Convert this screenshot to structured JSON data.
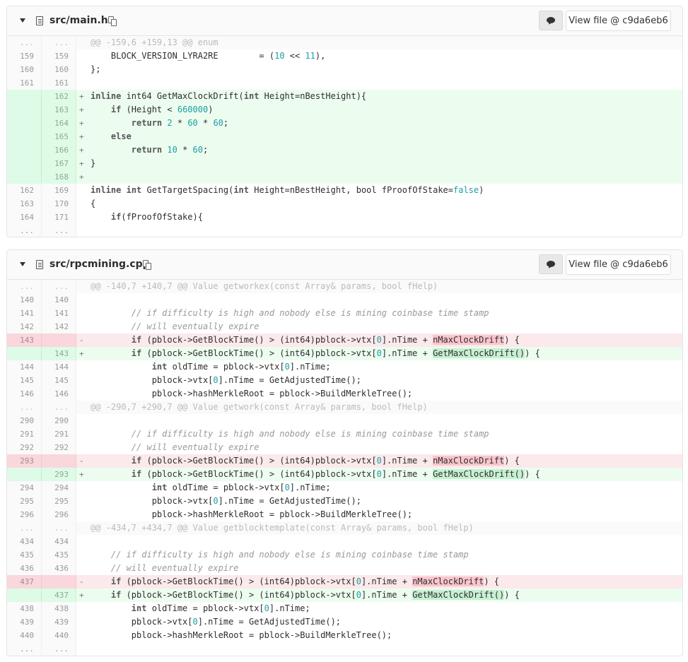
{
  "files": [
    {
      "name": "src/main.h",
      "view_button": "View file @ c9da6eb6",
      "lines": [
        {
          "t": "hunk",
          "o": "...",
          "n": "...",
          "s": "",
          "segs": [
            [
              "p",
              "@@ -159,6 +159,13 @@ enum"
            ]
          ]
        },
        {
          "t": "ctx",
          "o": "159",
          "n": "159",
          "s": "",
          "segs": [
            [
              "p",
              "    BLOCK_VERSION_LYRA2RE        = ("
            ],
            [
              "num",
              "10"
            ],
            [
              "p",
              " << "
            ],
            [
              "num",
              "11"
            ],
            [
              "p",
              "),"
            ]
          ]
        },
        {
          "t": "ctx",
          "o": "160",
          "n": "160",
          "s": "",
          "segs": [
            [
              "p",
              "};"
            ]
          ]
        },
        {
          "t": "ctx",
          "o": "161",
          "n": "161",
          "s": "",
          "segs": [
            [
              "p",
              ""
            ]
          ]
        },
        {
          "t": "add",
          "o": "",
          "n": "162",
          "s": "+",
          "segs": [
            [
              "kw",
              "inline"
            ],
            [
              "p",
              " int64 GetMaxClockDrift("
            ],
            [
              "kw",
              "int"
            ],
            [
              "p",
              " Height=nBestHeight){"
            ]
          ]
        },
        {
          "t": "add",
          "o": "",
          "n": "163",
          "s": "+",
          "segs": [
            [
              "p",
              "    "
            ],
            [
              "kw",
              "if"
            ],
            [
              "p",
              " (Height < "
            ],
            [
              "num",
              "660000"
            ],
            [
              "p",
              ")"
            ]
          ]
        },
        {
          "t": "add",
          "o": "",
          "n": "164",
          "s": "+",
          "segs": [
            [
              "p",
              "        "
            ],
            [
              "kw",
              "return"
            ],
            [
              "p",
              " "
            ],
            [
              "num",
              "2"
            ],
            [
              "p",
              " * "
            ],
            [
              "num",
              "60"
            ],
            [
              "p",
              " * "
            ],
            [
              "num",
              "60"
            ],
            [
              "p",
              ";"
            ]
          ]
        },
        {
          "t": "add",
          "o": "",
          "n": "165",
          "s": "+",
          "segs": [
            [
              "p",
              "    "
            ],
            [
              "kw",
              "else"
            ]
          ]
        },
        {
          "t": "add",
          "o": "",
          "n": "166",
          "s": "+",
          "segs": [
            [
              "p",
              "        "
            ],
            [
              "kw",
              "return"
            ],
            [
              "p",
              " "
            ],
            [
              "num",
              "10"
            ],
            [
              "p",
              " * "
            ],
            [
              "num",
              "60"
            ],
            [
              "p",
              ";"
            ]
          ]
        },
        {
          "t": "add",
          "o": "",
          "n": "167",
          "s": "+",
          "segs": [
            [
              "p",
              "}"
            ]
          ]
        },
        {
          "t": "add",
          "o": "",
          "n": "168",
          "s": "+",
          "segs": [
            [
              "p",
              ""
            ]
          ]
        },
        {
          "t": "ctx",
          "o": "162",
          "n": "169",
          "s": "",
          "segs": [
            [
              "kw",
              "inline"
            ],
            [
              "p",
              " "
            ],
            [
              "kw",
              "int"
            ],
            [
              "p",
              " GetTargetSpacing("
            ],
            [
              "kw",
              "int"
            ],
            [
              "p",
              " Height=nBestHeight, bool fProofOfStake="
            ],
            [
              "num",
              "false"
            ],
            [
              "p",
              ")"
            ]
          ]
        },
        {
          "t": "ctx",
          "o": "163",
          "n": "170",
          "s": "",
          "segs": [
            [
              "p",
              "{"
            ]
          ]
        },
        {
          "t": "ctx",
          "o": "164",
          "n": "171",
          "s": "",
          "segs": [
            [
              "p",
              "    "
            ],
            [
              "kw",
              "if"
            ],
            [
              "p",
              "(fProofOfStake){"
            ]
          ]
        },
        {
          "t": "ctx",
          "o": "...",
          "n": "...",
          "s": "",
          "segs": [
            [
              "p",
              ""
            ]
          ]
        }
      ]
    },
    {
      "name": "src/rpcmining.cpp",
      "view_button": "View file @ c9da6eb6",
      "lines": [
        {
          "t": "hunk",
          "o": "...",
          "n": "...",
          "s": "",
          "segs": [
            [
              "p",
              "@@ -140,7 +140,7 @@ Value getworkex(const Array& params, bool fHelp)"
            ]
          ]
        },
        {
          "t": "ctx",
          "o": "140",
          "n": "140",
          "s": "",
          "segs": [
            [
              "p",
              ""
            ]
          ]
        },
        {
          "t": "ctx",
          "o": "141",
          "n": "141",
          "s": "",
          "segs": [
            [
              "p",
              "        "
            ],
            [
              "cm",
              "// if difficulty is high and nobody else is mining coinbase time stamp"
            ]
          ]
        },
        {
          "t": "ctx",
          "o": "142",
          "n": "142",
          "s": "",
          "segs": [
            [
              "p",
              "        "
            ],
            [
              "cm",
              "// will eventually expire"
            ]
          ]
        },
        {
          "t": "del",
          "o": "143",
          "n": "",
          "s": "-",
          "segs": [
            [
              "p",
              "        "
            ],
            [
              "kw",
              "if"
            ],
            [
              "p",
              " (pblock->GetBlockTime() > (int64)pblock->vtx["
            ],
            [
              "num",
              "0"
            ],
            [
              "p",
              "].nTime + "
            ],
            [
              "hd",
              "nMaxClockDrift"
            ],
            [
              "p",
              ") {"
            ]
          ]
        },
        {
          "t": "add",
          "o": "",
          "n": "143",
          "s": "+",
          "segs": [
            [
              "p",
              "        "
            ],
            [
              "kw",
              "if"
            ],
            [
              "p",
              " (pblock->GetBlockTime() > (int64)pblock->vtx["
            ],
            [
              "num",
              "0"
            ],
            [
              "p",
              "].nTime + "
            ],
            [
              "ha",
              "GetMaxClockDrift()"
            ],
            [
              "p",
              ") {"
            ]
          ]
        },
        {
          "t": "ctx",
          "o": "144",
          "n": "144",
          "s": "",
          "segs": [
            [
              "p",
              "            "
            ],
            [
              "kw",
              "int"
            ],
            [
              "p",
              " oldTime = pblock->vtx["
            ],
            [
              "num",
              "0"
            ],
            [
              "p",
              "].nTime;"
            ]
          ]
        },
        {
          "t": "ctx",
          "o": "145",
          "n": "145",
          "s": "",
          "segs": [
            [
              "p",
              "            pblock->vtx["
            ],
            [
              "num",
              "0"
            ],
            [
              "p",
              "].nTime = GetAdjustedTime();"
            ]
          ]
        },
        {
          "t": "ctx",
          "o": "146",
          "n": "146",
          "s": "",
          "segs": [
            [
              "p",
              "            pblock->hashMerkleRoot = pblock->BuildMerkleTree();"
            ]
          ]
        },
        {
          "t": "hunk",
          "o": "...",
          "n": "...",
          "s": "",
          "segs": [
            [
              "p",
              "@@ -290,7 +290,7 @@ Value getwork(const Array& params, bool fHelp)"
            ]
          ]
        },
        {
          "t": "ctx",
          "o": "290",
          "n": "290",
          "s": "",
          "segs": [
            [
              "p",
              ""
            ]
          ]
        },
        {
          "t": "ctx",
          "o": "291",
          "n": "291",
          "s": "",
          "segs": [
            [
              "p",
              "        "
            ],
            [
              "cm",
              "// if difficulty is high and nobody else is mining coinbase time stamp"
            ]
          ]
        },
        {
          "t": "ctx",
          "o": "292",
          "n": "292",
          "s": "",
          "segs": [
            [
              "p",
              "        "
            ],
            [
              "cm",
              "// will eventually expire"
            ]
          ]
        },
        {
          "t": "del",
          "o": "293",
          "n": "",
          "s": "-",
          "segs": [
            [
              "p",
              "        "
            ],
            [
              "kw",
              "if"
            ],
            [
              "p",
              " (pblock->GetBlockTime() > (int64)pblock->vtx["
            ],
            [
              "num",
              "0"
            ],
            [
              "p",
              "].nTime + "
            ],
            [
              "hd",
              "nMaxClockDrift"
            ],
            [
              "p",
              ") {"
            ]
          ]
        },
        {
          "t": "add",
          "o": "",
          "n": "293",
          "s": "+",
          "segs": [
            [
              "p",
              "        "
            ],
            [
              "kw",
              "if"
            ],
            [
              "p",
              " (pblock->GetBlockTime() > (int64)pblock->vtx["
            ],
            [
              "num",
              "0"
            ],
            [
              "p",
              "].nTime + "
            ],
            [
              "ha",
              "GetMaxClockDrift()"
            ],
            [
              "p",
              ") {"
            ]
          ]
        },
        {
          "t": "ctx",
          "o": "294",
          "n": "294",
          "s": "",
          "segs": [
            [
              "p",
              "            "
            ],
            [
              "kw",
              "int"
            ],
            [
              "p",
              " oldTime = pblock->vtx["
            ],
            [
              "num",
              "0"
            ],
            [
              "p",
              "].nTime;"
            ]
          ]
        },
        {
          "t": "ctx",
          "o": "295",
          "n": "295",
          "s": "",
          "segs": [
            [
              "p",
              "            pblock->vtx["
            ],
            [
              "num",
              "0"
            ],
            [
              "p",
              "].nTime = GetAdjustedTime();"
            ]
          ]
        },
        {
          "t": "ctx",
          "o": "296",
          "n": "296",
          "s": "",
          "segs": [
            [
              "p",
              "            pblock->hashMerkleRoot = pblock->BuildMerkleTree();"
            ]
          ]
        },
        {
          "t": "hunk",
          "o": "...",
          "n": "...",
          "s": "",
          "segs": [
            [
              "p",
              "@@ -434,7 +434,7 @@ Value getblocktemplate(const Array& params, bool fHelp)"
            ]
          ]
        },
        {
          "t": "ctx",
          "o": "434",
          "n": "434",
          "s": "",
          "segs": [
            [
              "p",
              ""
            ]
          ]
        },
        {
          "t": "ctx",
          "o": "435",
          "n": "435",
          "s": "",
          "segs": [
            [
              "p",
              "    "
            ],
            [
              "cm",
              "// if difficulty is high and nobody else is mining coinbase time stamp"
            ]
          ]
        },
        {
          "t": "ctx",
          "o": "436",
          "n": "436",
          "s": "",
          "segs": [
            [
              "p",
              "    "
            ],
            [
              "cm",
              "// will eventually expire"
            ]
          ]
        },
        {
          "t": "del",
          "o": "437",
          "n": "",
          "s": "-",
          "segs": [
            [
              "p",
              "    "
            ],
            [
              "kw",
              "if"
            ],
            [
              "p",
              " (pblock->GetBlockTime() > (int64)pblock->vtx["
            ],
            [
              "num",
              "0"
            ],
            [
              "p",
              "].nTime + "
            ],
            [
              "hd",
              "nMaxClockDrift"
            ],
            [
              "p",
              ") {"
            ]
          ]
        },
        {
          "t": "add",
          "o": "",
          "n": "437",
          "s": "+",
          "segs": [
            [
              "p",
              "    "
            ],
            [
              "kw",
              "if"
            ],
            [
              "p",
              " (pblock->GetBlockTime() > (int64)pblock->vtx["
            ],
            [
              "num",
              "0"
            ],
            [
              "p",
              "].nTime + "
            ],
            [
              "ha",
              "GetMaxClockDrift()"
            ],
            [
              "p",
              ") {"
            ]
          ]
        },
        {
          "t": "ctx",
          "o": "438",
          "n": "438",
          "s": "",
          "segs": [
            [
              "p",
              "        "
            ],
            [
              "kw",
              "int"
            ],
            [
              "p",
              " oldTime = pblock->vtx["
            ],
            [
              "num",
              "0"
            ],
            [
              "p",
              "].nTime;"
            ]
          ]
        },
        {
          "t": "ctx",
          "o": "439",
          "n": "439",
          "s": "",
          "segs": [
            [
              "p",
              "        pblock->vtx["
            ],
            [
              "num",
              "0"
            ],
            [
              "p",
              "].nTime = GetAdjustedTime();"
            ]
          ]
        },
        {
          "t": "ctx",
          "o": "440",
          "n": "440",
          "s": "",
          "segs": [
            [
              "p",
              "        pblock->hashMerkleRoot = pblock->BuildMerkleTree();"
            ]
          ]
        },
        {
          "t": "ctx",
          "o": "...",
          "n": "...",
          "s": "",
          "segs": [
            [
              "p",
              ""
            ]
          ]
        }
      ]
    }
  ],
  "icons": {
    "collapse": "caret-down-icon",
    "file": "file-icon",
    "copy": "copy-icon",
    "comment": "comment-icon"
  }
}
